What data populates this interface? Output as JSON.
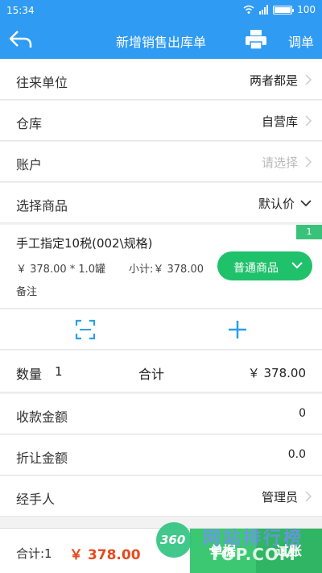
{
  "status": {
    "time": "15:34",
    "battery": "100",
    "battery_level": 1.0
  },
  "header": {
    "title": "新增销售出库单",
    "adjust_label": "调单"
  },
  "form": {
    "partner": {
      "label": "往来单位",
      "value": "两者都是"
    },
    "warehouse": {
      "label": "仓库",
      "value": "自营库"
    },
    "account": {
      "label": "账户",
      "placeholder": "请选择"
    },
    "select_goods": {
      "label": "选择商品",
      "value": "默认价"
    }
  },
  "item": {
    "name": "手工指定10税(002\\规格)",
    "price_line": "￥ 378.00 * 1.0罐",
    "subtotal": "小计:￥ 378.00",
    "note_label": "备注",
    "badge": "1",
    "type_button": "普通商品"
  },
  "summary": {
    "qty_label": "数量",
    "qty": "1",
    "total_label": "合计",
    "total": "￥ 378.00"
  },
  "payment": {
    "received": {
      "label": "收款金额",
      "value": "0"
    },
    "discount": {
      "label": "折让金额",
      "value": "0.0"
    },
    "handler": {
      "label": "经手人",
      "value": "管理员"
    }
  },
  "bottom": {
    "total_label": "合计:1",
    "amount": "￥ 378.00",
    "btn_save": "单据",
    "btn_submit": "过账"
  },
  "watermark": {
    "logo": "360",
    "line1": "网站排行榜",
    "line2": "TOP.COM"
  },
  "colors": {
    "primary": "#2f9bf2",
    "green": "#20c16b",
    "accent_red": "#e8481c"
  }
}
